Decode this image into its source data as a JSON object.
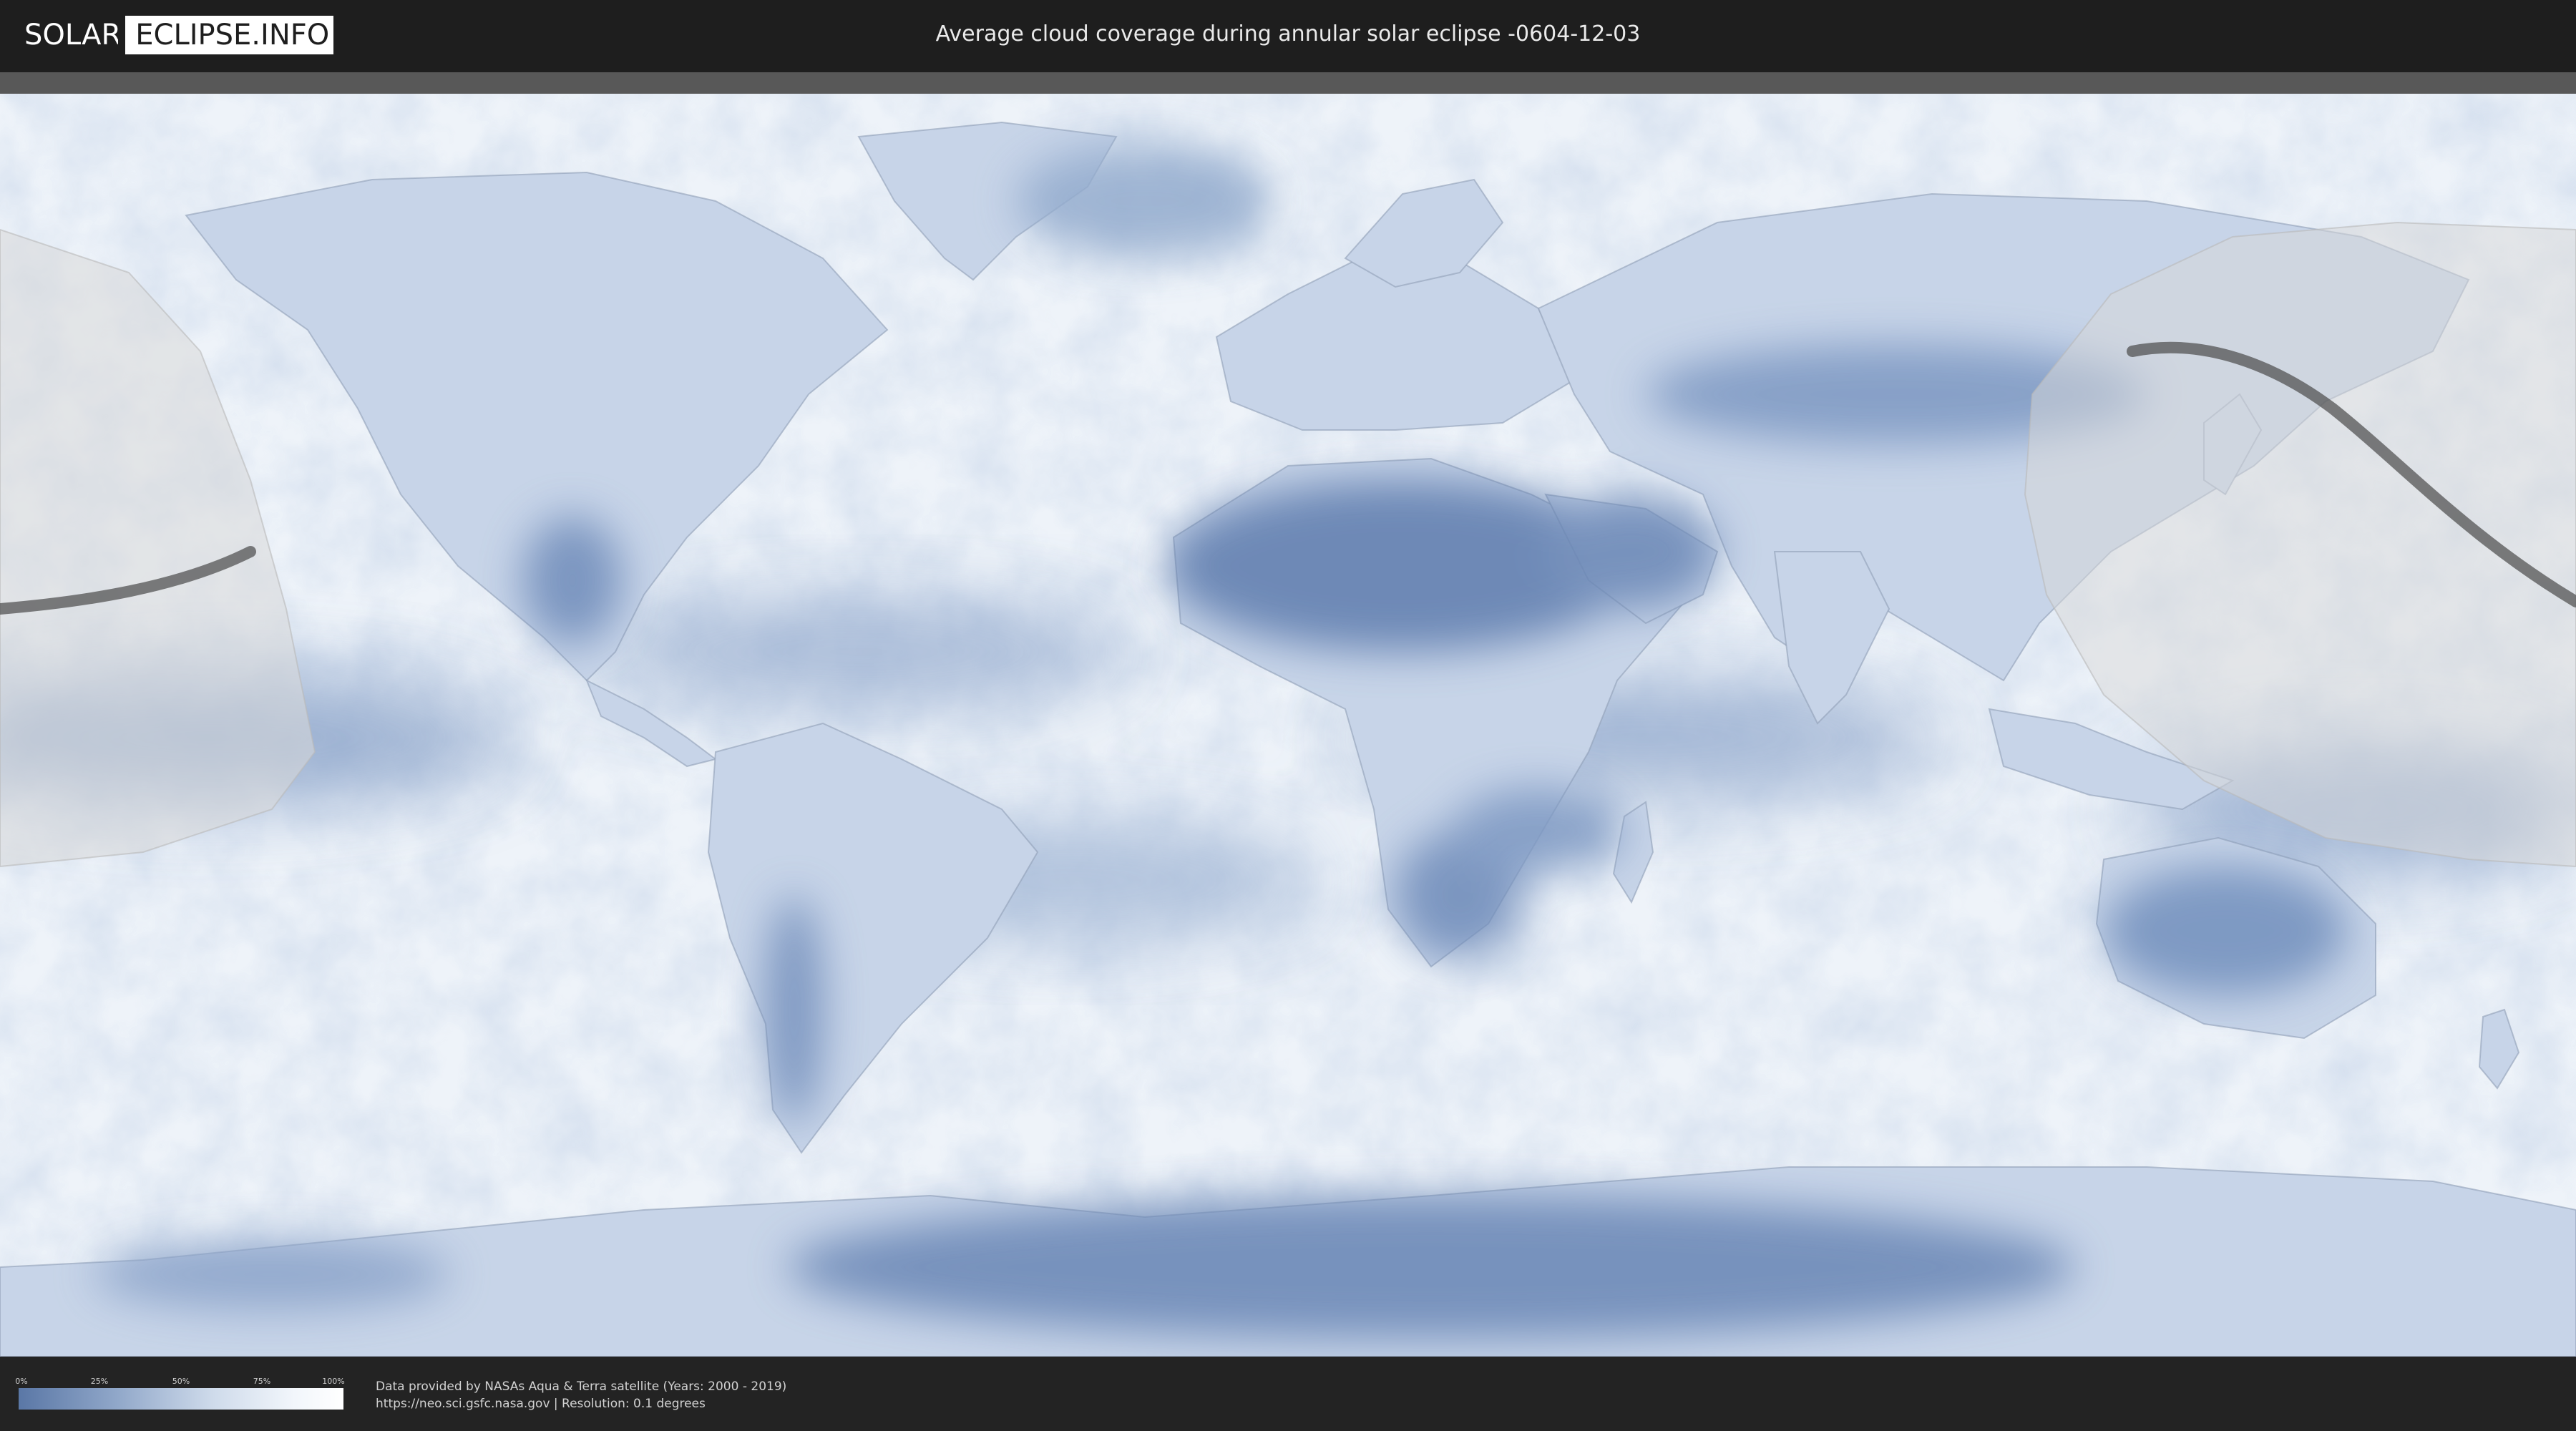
{
  "header": {
    "logo_part1": "SOLAR",
    "logo_part2": "ECLIPSE.INFO",
    "title": "Average cloud coverage during annular solar eclipse -0604-12-03"
  },
  "legend": {
    "ticks": [
      "0%",
      "25%",
      "50%",
      "75%",
      "100%"
    ],
    "colors": {
      "low": "#5a77a6",
      "mid": "#cfdbeb",
      "high": "#ffffff"
    }
  },
  "footer": {
    "credit_line1": "Data provided by NASAs Aqua & Terra satellite (Years: 2000 - 2019)",
    "credit_line2": "https://neo.sci.gsfc.nasa.gov | Resolution: 0.1 degrees"
  },
  "map": {
    "projection": "equirectangular",
    "colors": {
      "clear_sky": "#5f7dae",
      "overcast": "#ffffff",
      "umbra_path": "#4a4a4a",
      "visibility_zone": "#d6d6d6"
    }
  }
}
